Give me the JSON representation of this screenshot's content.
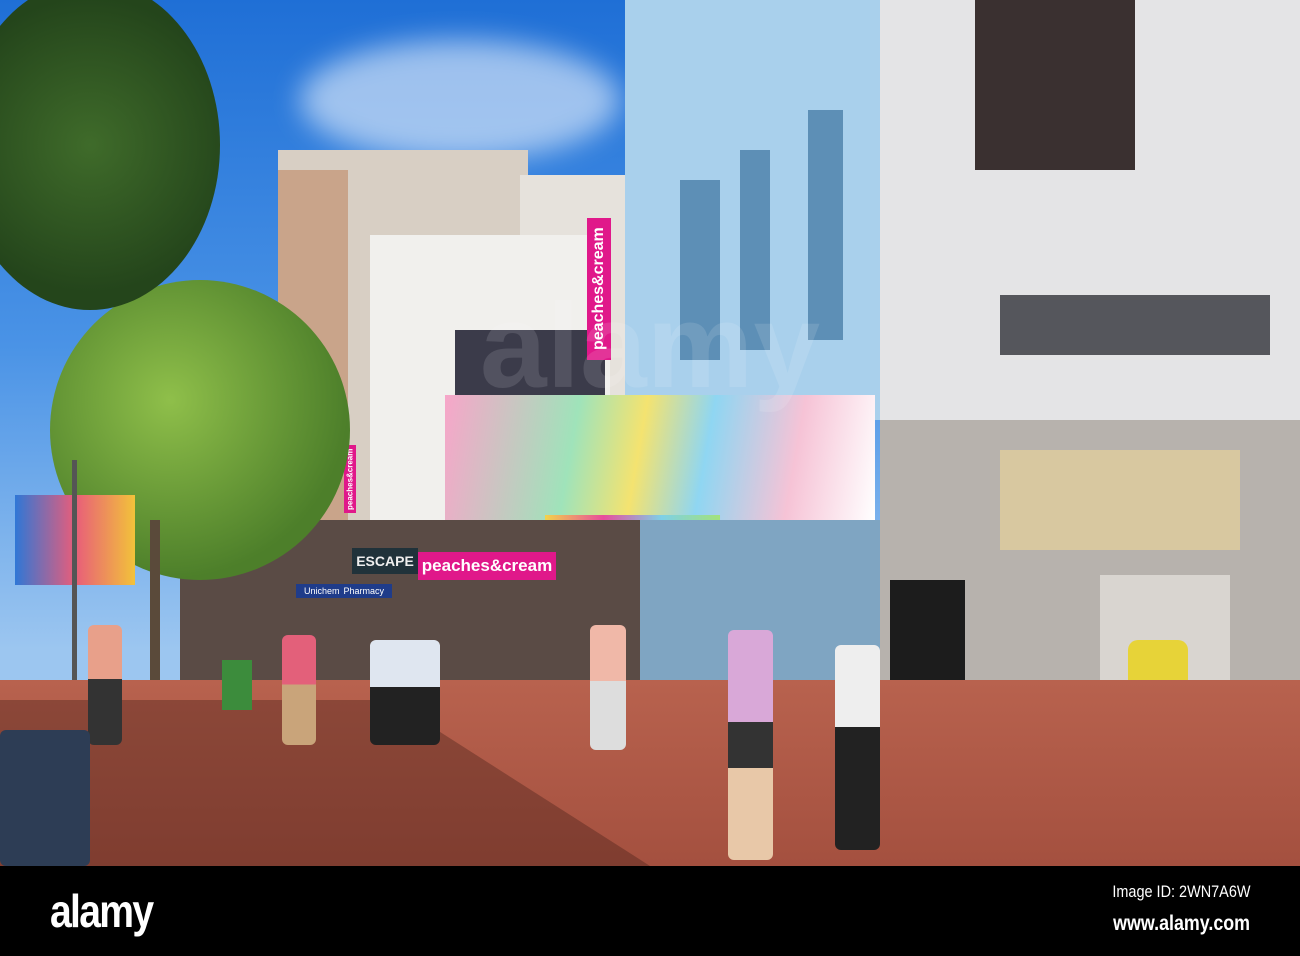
{
  "photo": {
    "signs": {
      "peaches_vertical": "peaches&cream",
      "peaches_small_vertical": "peaches&cream",
      "peaches_horizontal": "peaches&cream",
      "escape": "ESCAPE",
      "pharmacy_name": "Unichem",
      "pharmacy_label": "Pharmacy"
    },
    "watermark": "alamy"
  },
  "footer": {
    "logo": "alamy",
    "image_id": "Image ID: 2WN7A6W",
    "url": "www.alamy.com"
  }
}
